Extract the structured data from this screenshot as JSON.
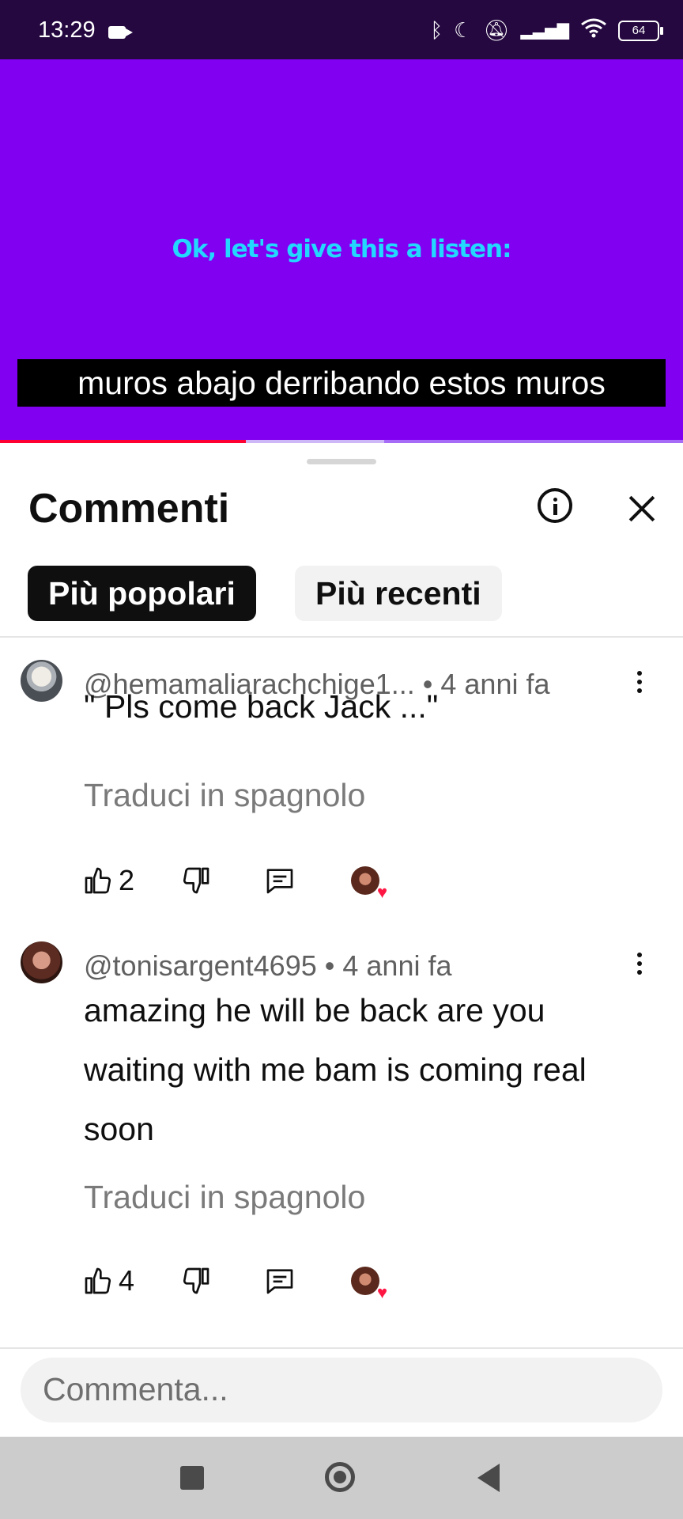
{
  "status_bar": {
    "time": "13:29",
    "battery": "64",
    "icons": [
      "camera-icon",
      "bluetooth-icon",
      "moon-icon",
      "mute-icon",
      "signal-icon",
      "wifi-icon",
      "battery-icon"
    ]
  },
  "video": {
    "caption_top": "Ok, let's give this a listen:",
    "subtitle": "muros abajo derribando estos muros",
    "progress": 0.36
  },
  "comments_panel": {
    "title": "Commenti",
    "tabs": [
      {
        "label": "Più popolari",
        "active": true
      },
      {
        "label": "Più recenti",
        "active": false
      }
    ],
    "comments": [
      {
        "author": "@hemamaliarachchige1...",
        "time": "4 anni fa",
        "text": "\" Pls come back Jack ...\"",
        "translate": "Traduci in spagnolo",
        "likes": "2"
      },
      {
        "author": "@tonisargent4695",
        "time": "4 anni fa",
        "text": "amazing he will be back  are you  waiting with me bam is coming real soon",
        "translate": "Traduci in spagnolo",
        "likes": "4"
      }
    ],
    "input_placeholder": "Commenta..."
  },
  "colors": {
    "video_bg": "#8200f2",
    "caption_cyan": "#22d8ff",
    "progress_red": "#ff0033",
    "heart_red": "#ff1744"
  }
}
